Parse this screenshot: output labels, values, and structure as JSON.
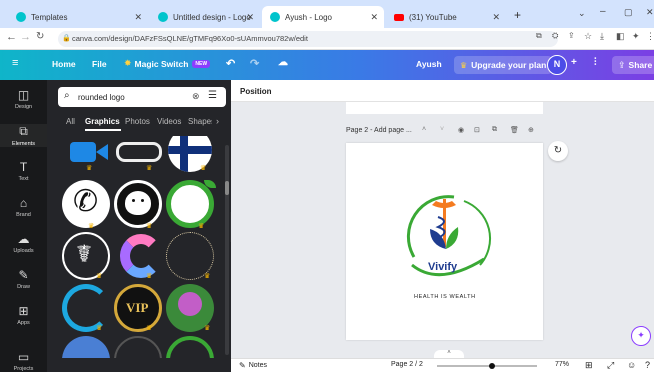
{
  "browser": {
    "tabs": [
      {
        "title": "Templates",
        "color": "#00c4cc"
      },
      {
        "title": "Untitled design - Logo",
        "color": "#00c4cc"
      },
      {
        "title": "Ayush - Logo",
        "color": "#00c4cc"
      },
      {
        "title": "(31) YouTube",
        "color": "#ff0000"
      }
    ],
    "new_tab": "+",
    "url": "canva.com/design/DAFzFSsQLNE/gTMFq96Xo0-sUAmmvou782w/edit"
  },
  "topbar": {
    "home": "Home",
    "file": "File",
    "magic_switch": "Magic Switch",
    "new_badge": "NEW",
    "user": "Ayush",
    "upgrade": "Upgrade your plan",
    "avatar": "N",
    "share": "Share"
  },
  "rail": [
    {
      "label": "Design",
      "icon": "layout-icon"
    },
    {
      "label": "Elements",
      "icon": "shapes-icon"
    },
    {
      "label": "Text",
      "icon": "text-icon"
    },
    {
      "label": "Brand",
      "icon": "brand-icon"
    },
    {
      "label": "Uploads",
      "icon": "cloud-upload-icon"
    },
    {
      "label": "Draw",
      "icon": "pen-icon"
    },
    {
      "label": "Apps",
      "icon": "grid-icon"
    },
    {
      "label": "Projects",
      "icon": "folder-icon"
    }
  ],
  "panel": {
    "search_value": "rounded logo",
    "tabs": [
      "All",
      "Graphics",
      "Photos",
      "Videos",
      "Shapes"
    ],
    "active_tab": "Graphics"
  },
  "workspace": {
    "position_label": "Position",
    "page_label": "Page 2 - Add page ...",
    "logo_name": "Vivify",
    "logo_tagline": "HEALTH IS WEALTH"
  },
  "status": {
    "notes": "Notes",
    "page_indicator": "Page 2 / 2",
    "zoom": "77%",
    "zoom_level": 0.77
  },
  "colors": {
    "accent": "#8b3dff",
    "logo_green": "#3aa935",
    "logo_blue": "#1f3c8f",
    "logo_orange": "#f47b20"
  }
}
